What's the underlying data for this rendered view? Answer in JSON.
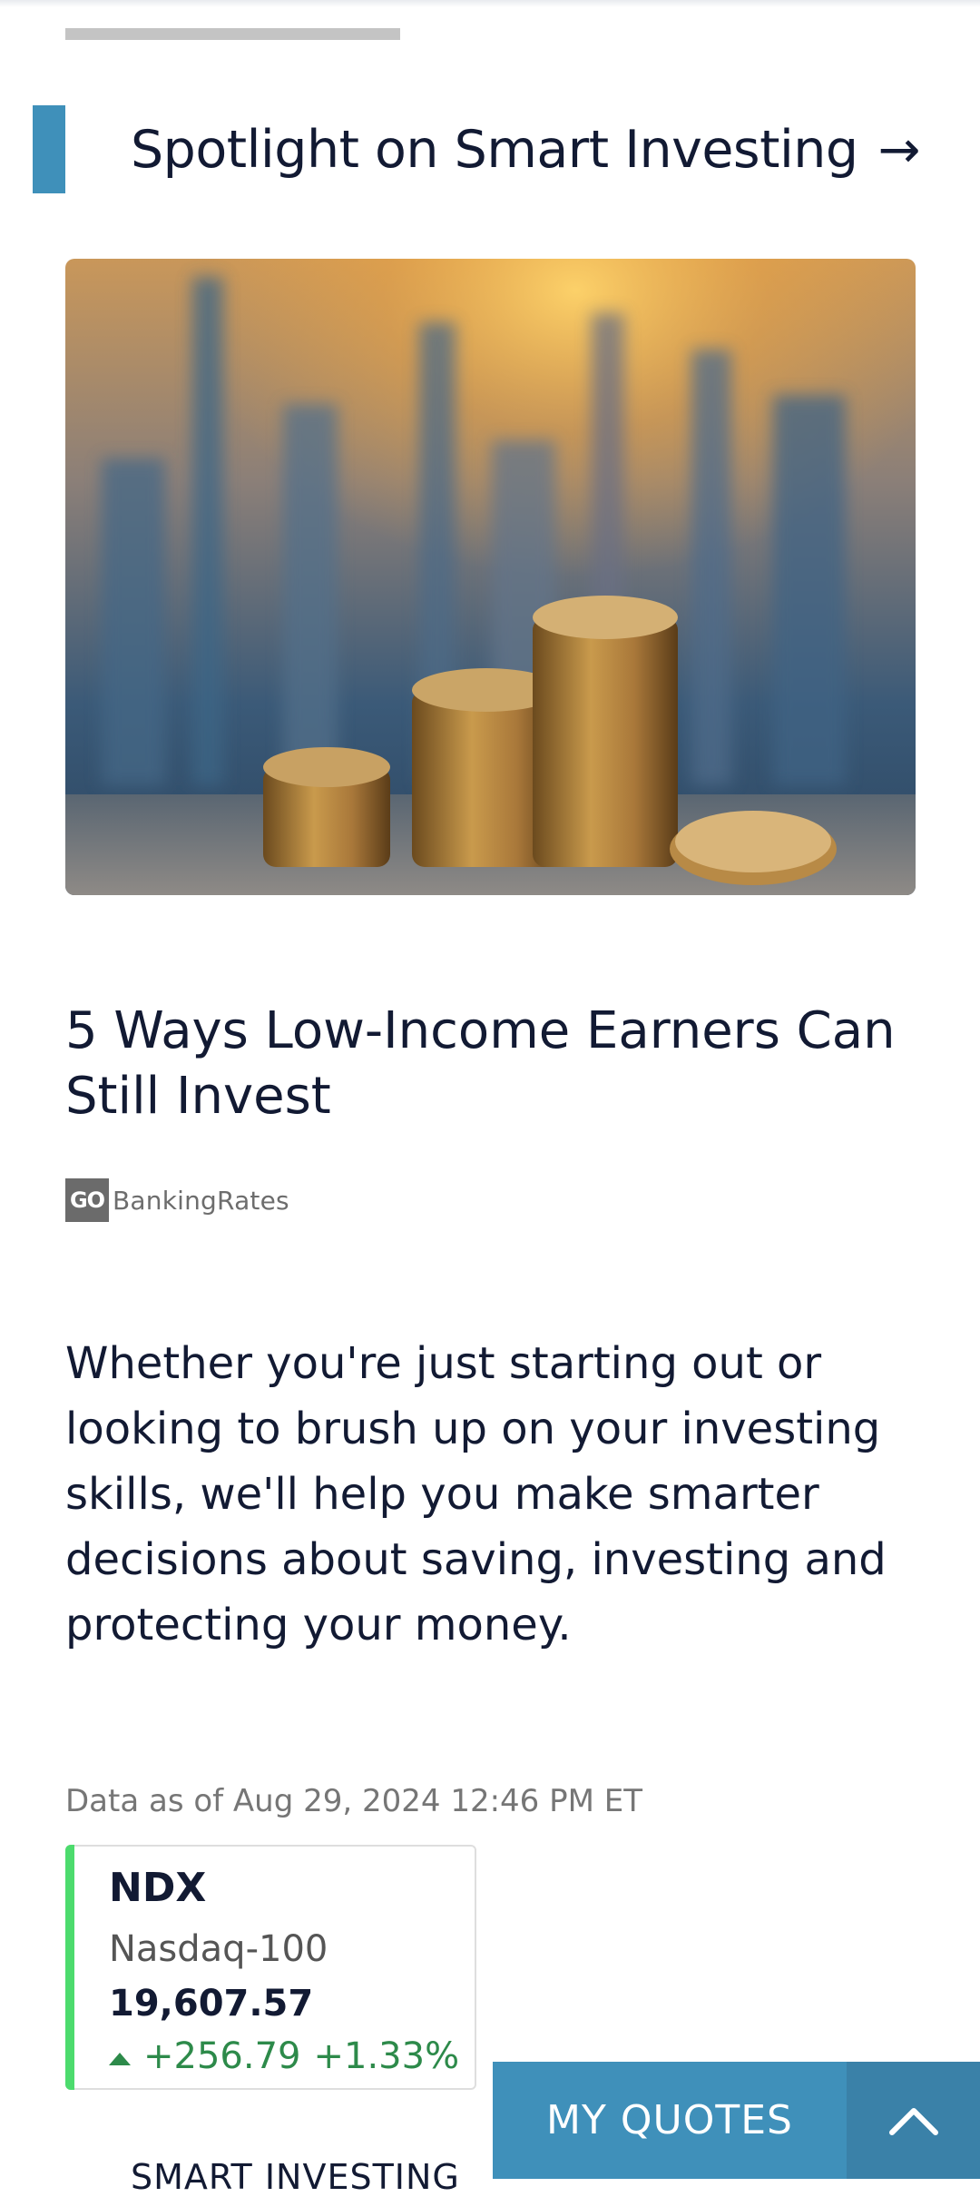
{
  "section": {
    "title": "Spotlight on Smart Investing",
    "arrow_icon": "arrow-right-icon"
  },
  "article": {
    "image_alt": "Stacks of gold coins in front of a blurred city skyline at sunset",
    "title": "5 Ways Low-Income Earners Can Still Invest",
    "source_logo_text": "GO",
    "source_name": "BankingRates",
    "summary": "Whether you're just starting out or looking to brush up on your investing skills, we'll help you make smarter decisions about saving, investing and protecting your money."
  },
  "market": {
    "data_as_of": "Data as of Aug 29, 2024 12:46 PM ET",
    "quote": {
      "symbol": "NDX",
      "name": "Nasdaq-100",
      "price": "19,607.57",
      "change": "+256.79",
      "change_pct": "+1.33%",
      "direction": "up"
    }
  },
  "next_section_label": "SMART INVESTING",
  "quotes_bar": {
    "label": "MY QUOTES",
    "expand_icon": "chevron-up-icon"
  },
  "colors": {
    "accent": "#3f90ba",
    "positive": "#2d8a4a",
    "card_bar": "#4cdb6d",
    "text": "#121a33"
  }
}
